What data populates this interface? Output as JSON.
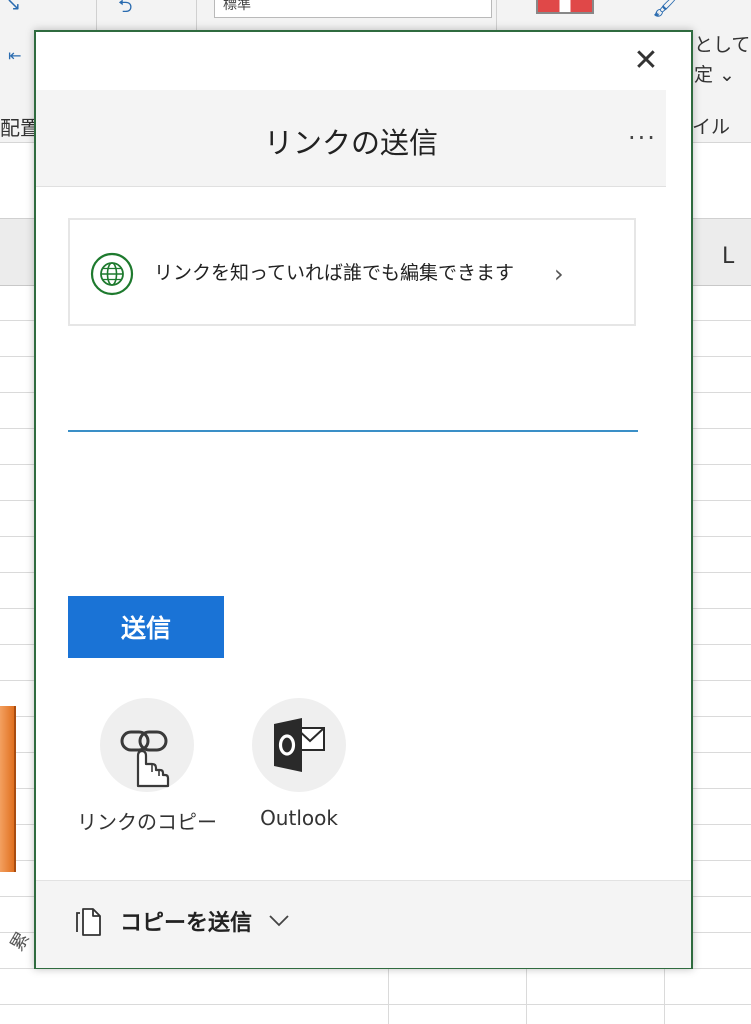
{
  "background": {
    "ribbon_input_value": "標準",
    "ribbon_left_label": "配置",
    "ribbon_right_label_1": "として",
    "ribbon_right_label_2": "定 ⌄",
    "ribbon_right_label_3": "イル",
    "column_header": "L",
    "vertical_char": "累"
  },
  "dialog": {
    "close_symbol": "✕",
    "title": "リンクの送信",
    "more_symbol": "···",
    "permission": {
      "text": "リンクを知っていれば誰でも編集できます",
      "chevron": "›"
    },
    "recipient_placeholder": "",
    "send_label": "送信",
    "share_options": [
      {
        "label": "リンクのコピー",
        "icon": "link-copy-icon"
      },
      {
        "label": "Outlook",
        "icon": "outlook-icon"
      }
    ],
    "footer": {
      "label": "コピーを送信",
      "icon": "copy-icon"
    }
  },
  "colors": {
    "accent": "#1a73d6",
    "dialog_border": "#2f6b3f",
    "globe": "#1e7a2e",
    "input_underline": "#3a8fc7"
  }
}
